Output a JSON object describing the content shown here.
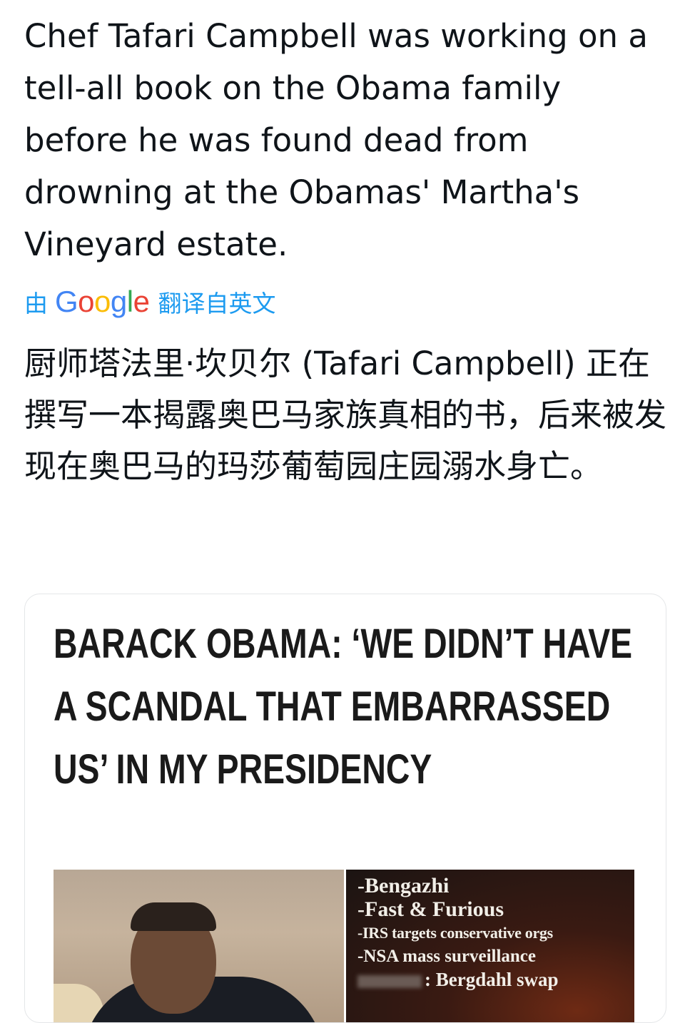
{
  "tweet": {
    "text": "Chef Tafari Campbell was working on a tell-all book on the Obama family before he was found dead from drowning at the Obamas' Martha's Vineyard estate.",
    "translation_prefix": "由",
    "translation_provider": {
      "letters": [
        "G",
        "o",
        "o",
        "g",
        "l",
        "e"
      ]
    },
    "translation_suffix": "翻译自英文",
    "translated_text": "厨师塔法里·坎贝尔 (Tafari Campbell) 正在撰写一本揭露奥巴马家族真相的书，后来被发现在奥巴马的玛莎葡萄园庄园溺水身亡。"
  },
  "media": {
    "headline": "BARACK OBAMA: ‘WE DIDN’T HAVE A SCANDAL THAT EMBARRASSED US’ IN MY PRESIDENCY",
    "scandal_list": [
      "-Bengazhi",
      "-Fast & Furious",
      "-IRS targets conservative orgs",
      "-NSA mass surveillance",
      ": Bergdahl swap"
    ]
  },
  "colors": {
    "text": "#0f1419",
    "link": "#1d9bf0",
    "card_border": "#e4e6e8"
  }
}
